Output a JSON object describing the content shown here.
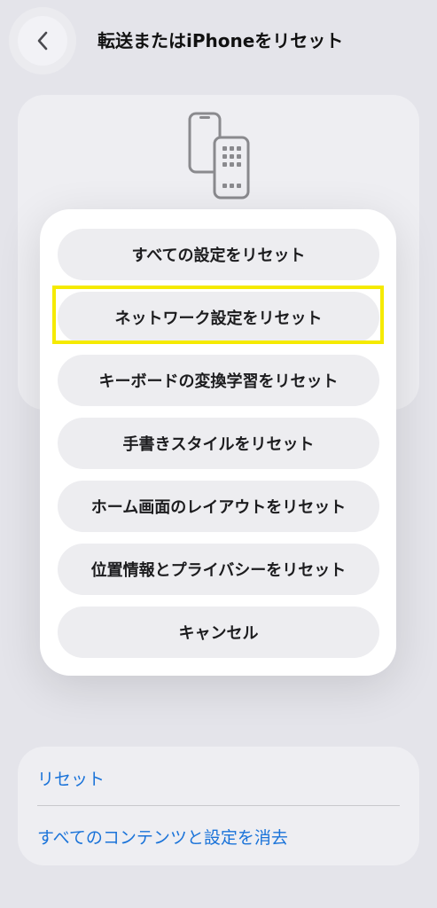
{
  "nav": {
    "title": "転送またはiPhoneをリセット",
    "back_icon": "chevron-left-icon"
  },
  "hero": {
    "icon": "iphone-transfer-icon"
  },
  "action_sheet": {
    "items": [
      {
        "label": "すべての設定をリセット"
      },
      {
        "label": "ネットワーク設定をリセット",
        "highlighted": true
      },
      {
        "label": "キーボードの変換学習をリセット"
      },
      {
        "label": "手書きスタイルをリセット"
      },
      {
        "label": "ホーム画面のレイアウトをリセット"
      },
      {
        "label": "位置情報とプライバシーをリセット"
      },
      {
        "label": "キャンセル"
      }
    ]
  },
  "bottom_card": {
    "reset_label": "リセット",
    "erase_label": "すべてのコンテンツと設定を消去"
  },
  "colors": {
    "background": "#e4e4ea",
    "link": "#1a73d9",
    "highlight": "#f5ea00"
  }
}
